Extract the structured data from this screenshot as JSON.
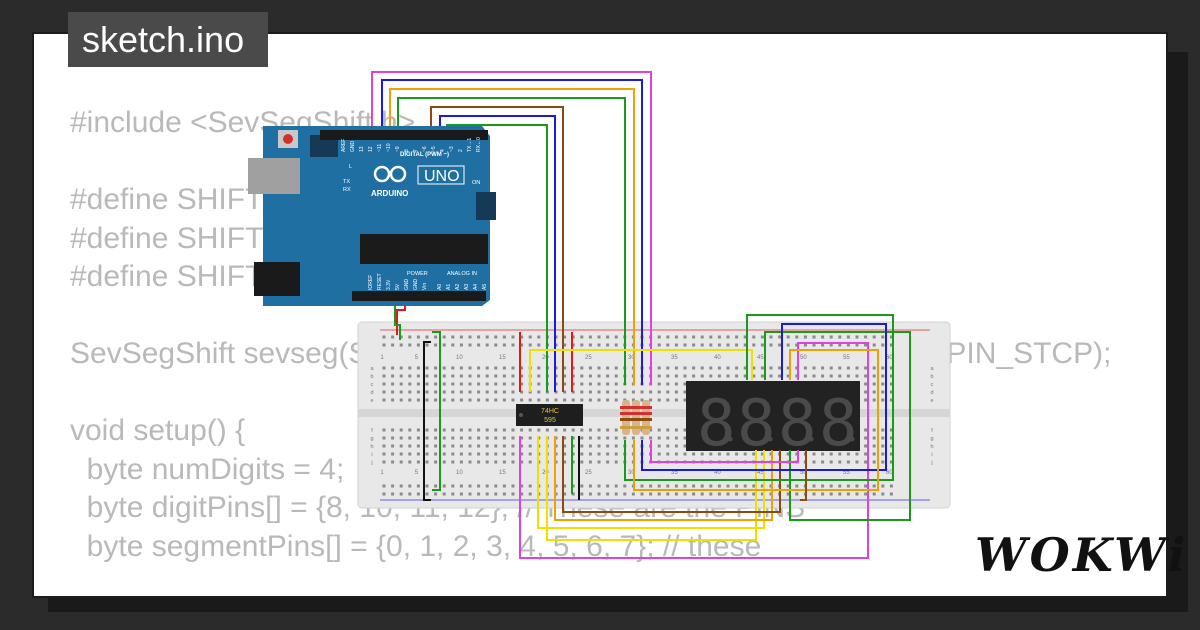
{
  "title": "sketch.ino",
  "logo": "WOKWi",
  "code_lines": [
    "#include <SevSegShift.h>",
    "",
    "#define SHIFT_PIN_DS   13",
    "#define SHIFT_PIN_STCP 12",
    "#define SHIFT_PIN_SHCP 11",
    "",
    "SevSegShift sevseg(SHIFT_PIN_DS, SHIFT_PIN_SHCP, SHIFT_PIN_STCP);",
    "",
    "void setup() {",
    "  byte numDigits = 4;",
    "  byte digitPins[] = {8, 10, 11, 12}; // These are the PINS",
    "  byte segmentPins[] = {0, 1, 2, 3, 4, 5, 6, 7}; // these"
  ],
  "arduino": {
    "logo_text": "ARDUINO",
    "model": "UNO",
    "digital_header": "DIGITAL (PWM ~)",
    "top_pins": [
      "AREF",
      "GND",
      "13",
      "12",
      "~11",
      "~10",
      "~9",
      "8",
      "7",
      "~6",
      "~5",
      "4",
      "~3",
      "2",
      "TX→1",
      "RX←0"
    ],
    "power_header": "POWER",
    "analog_header": "ANALOG IN",
    "power_pins": [
      "IOREF",
      "RESET",
      "3.3V",
      "5V",
      "GND",
      "GND",
      "Vin"
    ],
    "analog_pins": [
      "A0",
      "A1",
      "A2",
      "A3",
      "A4",
      "A5"
    ],
    "leds": [
      "L",
      "TX",
      "RX",
      "ON"
    ]
  },
  "shift_register": {
    "line1": "74HC",
    "line2": "595"
  },
  "breadboard": {
    "column_numbers": [
      "1",
      "5",
      "10",
      "15",
      "20",
      "25",
      "30",
      "35",
      "40",
      "45",
      "50",
      "55",
      "60"
    ],
    "row_letters_top": [
      "a",
      "b",
      "c",
      "d",
      "e"
    ],
    "row_letters_bottom": [
      "f",
      "g",
      "h",
      "i",
      "j"
    ]
  },
  "display": {
    "digits": [
      "8",
      "8",
      "8",
      "8"
    ]
  },
  "colors": {
    "background": "#2b2b2b",
    "card": "#ffffff",
    "code_text": "#b9b9b9",
    "title_tab": "#4a4a4a",
    "arduino_board": "#1f6fa3",
    "breadboard": "#e8e8e8",
    "display_body": "#222222",
    "wire_magenta": "#e040e0",
    "wire_blue": "#1a1ae0",
    "wire_orange": "#f0a000",
    "wire_brown": "#8a4a10",
    "wire_green": "#1a9a1a",
    "wire_yellow": "#f0e000",
    "wire_red": "#e01a1a",
    "wire_black": "#111111"
  }
}
